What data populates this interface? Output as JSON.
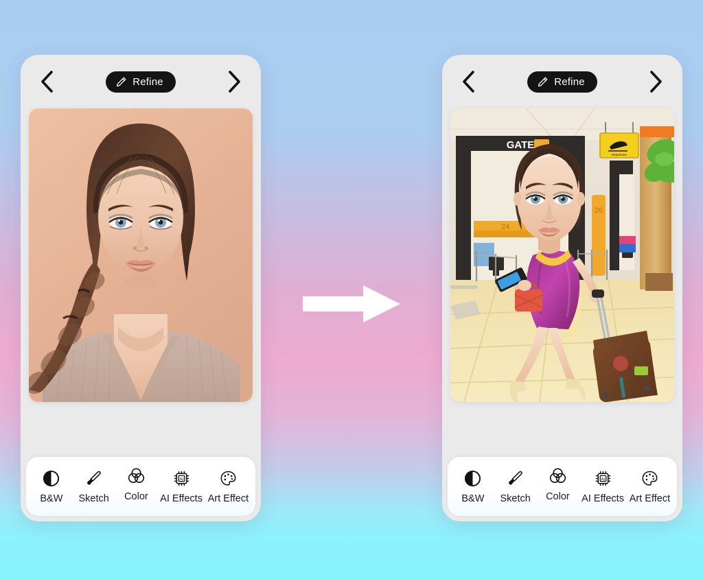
{
  "background": {
    "gradient_top": "#a9cdf1",
    "gradient_mid": "#eeaad0",
    "gradient_bottom": "#86f3fc"
  },
  "center_arrow": {
    "icon": "arrow-right-icon",
    "color": "#ffffff",
    "direction": "right"
  },
  "phones": [
    {
      "id": "before",
      "header": {
        "back_icon": "chevron-left-icon",
        "forward_icon": "chevron-right-icon",
        "refine_label": "Refine",
        "refine_icon": "pencil-icon"
      },
      "image": {
        "alt": "portrait photo of woman with braided hair on peach background",
        "background_color": "#e8b897"
      },
      "toolbar": [
        {
          "label": "B&W",
          "icon": "contrast-circle-icon"
        },
        {
          "label": "Sketch",
          "icon": "paintbrush-icon"
        },
        {
          "label": "Color",
          "icon": "overlapping-circles-icon"
        },
        {
          "label": "AI Effects",
          "icon": "ai-chip-icon"
        },
        {
          "label": "Art Effect",
          "icon": "palette-icon"
        }
      ]
    },
    {
      "id": "after",
      "header": {
        "back_icon": "chevron-left-icon",
        "forward_icon": "chevron-right-icon",
        "refine_label": "Refine",
        "refine_icon": "pencil-icon"
      },
      "image": {
        "alt": "caricature of woman in purple dress pulling suitcase in airport terminal",
        "background_color": "#f3e3b9",
        "scene_texts": [
          "GATE",
          "Departures",
          "24",
          "26"
        ]
      },
      "toolbar": [
        {
          "label": "B&W",
          "icon": "contrast-circle-icon"
        },
        {
          "label": "Sketch",
          "icon": "paintbrush-icon"
        },
        {
          "label": "Color",
          "icon": "overlapping-circles-icon"
        },
        {
          "label": "AI Effects",
          "icon": "ai-chip-icon"
        },
        {
          "label": "Art Effect",
          "icon": "palette-icon"
        }
      ]
    }
  ]
}
